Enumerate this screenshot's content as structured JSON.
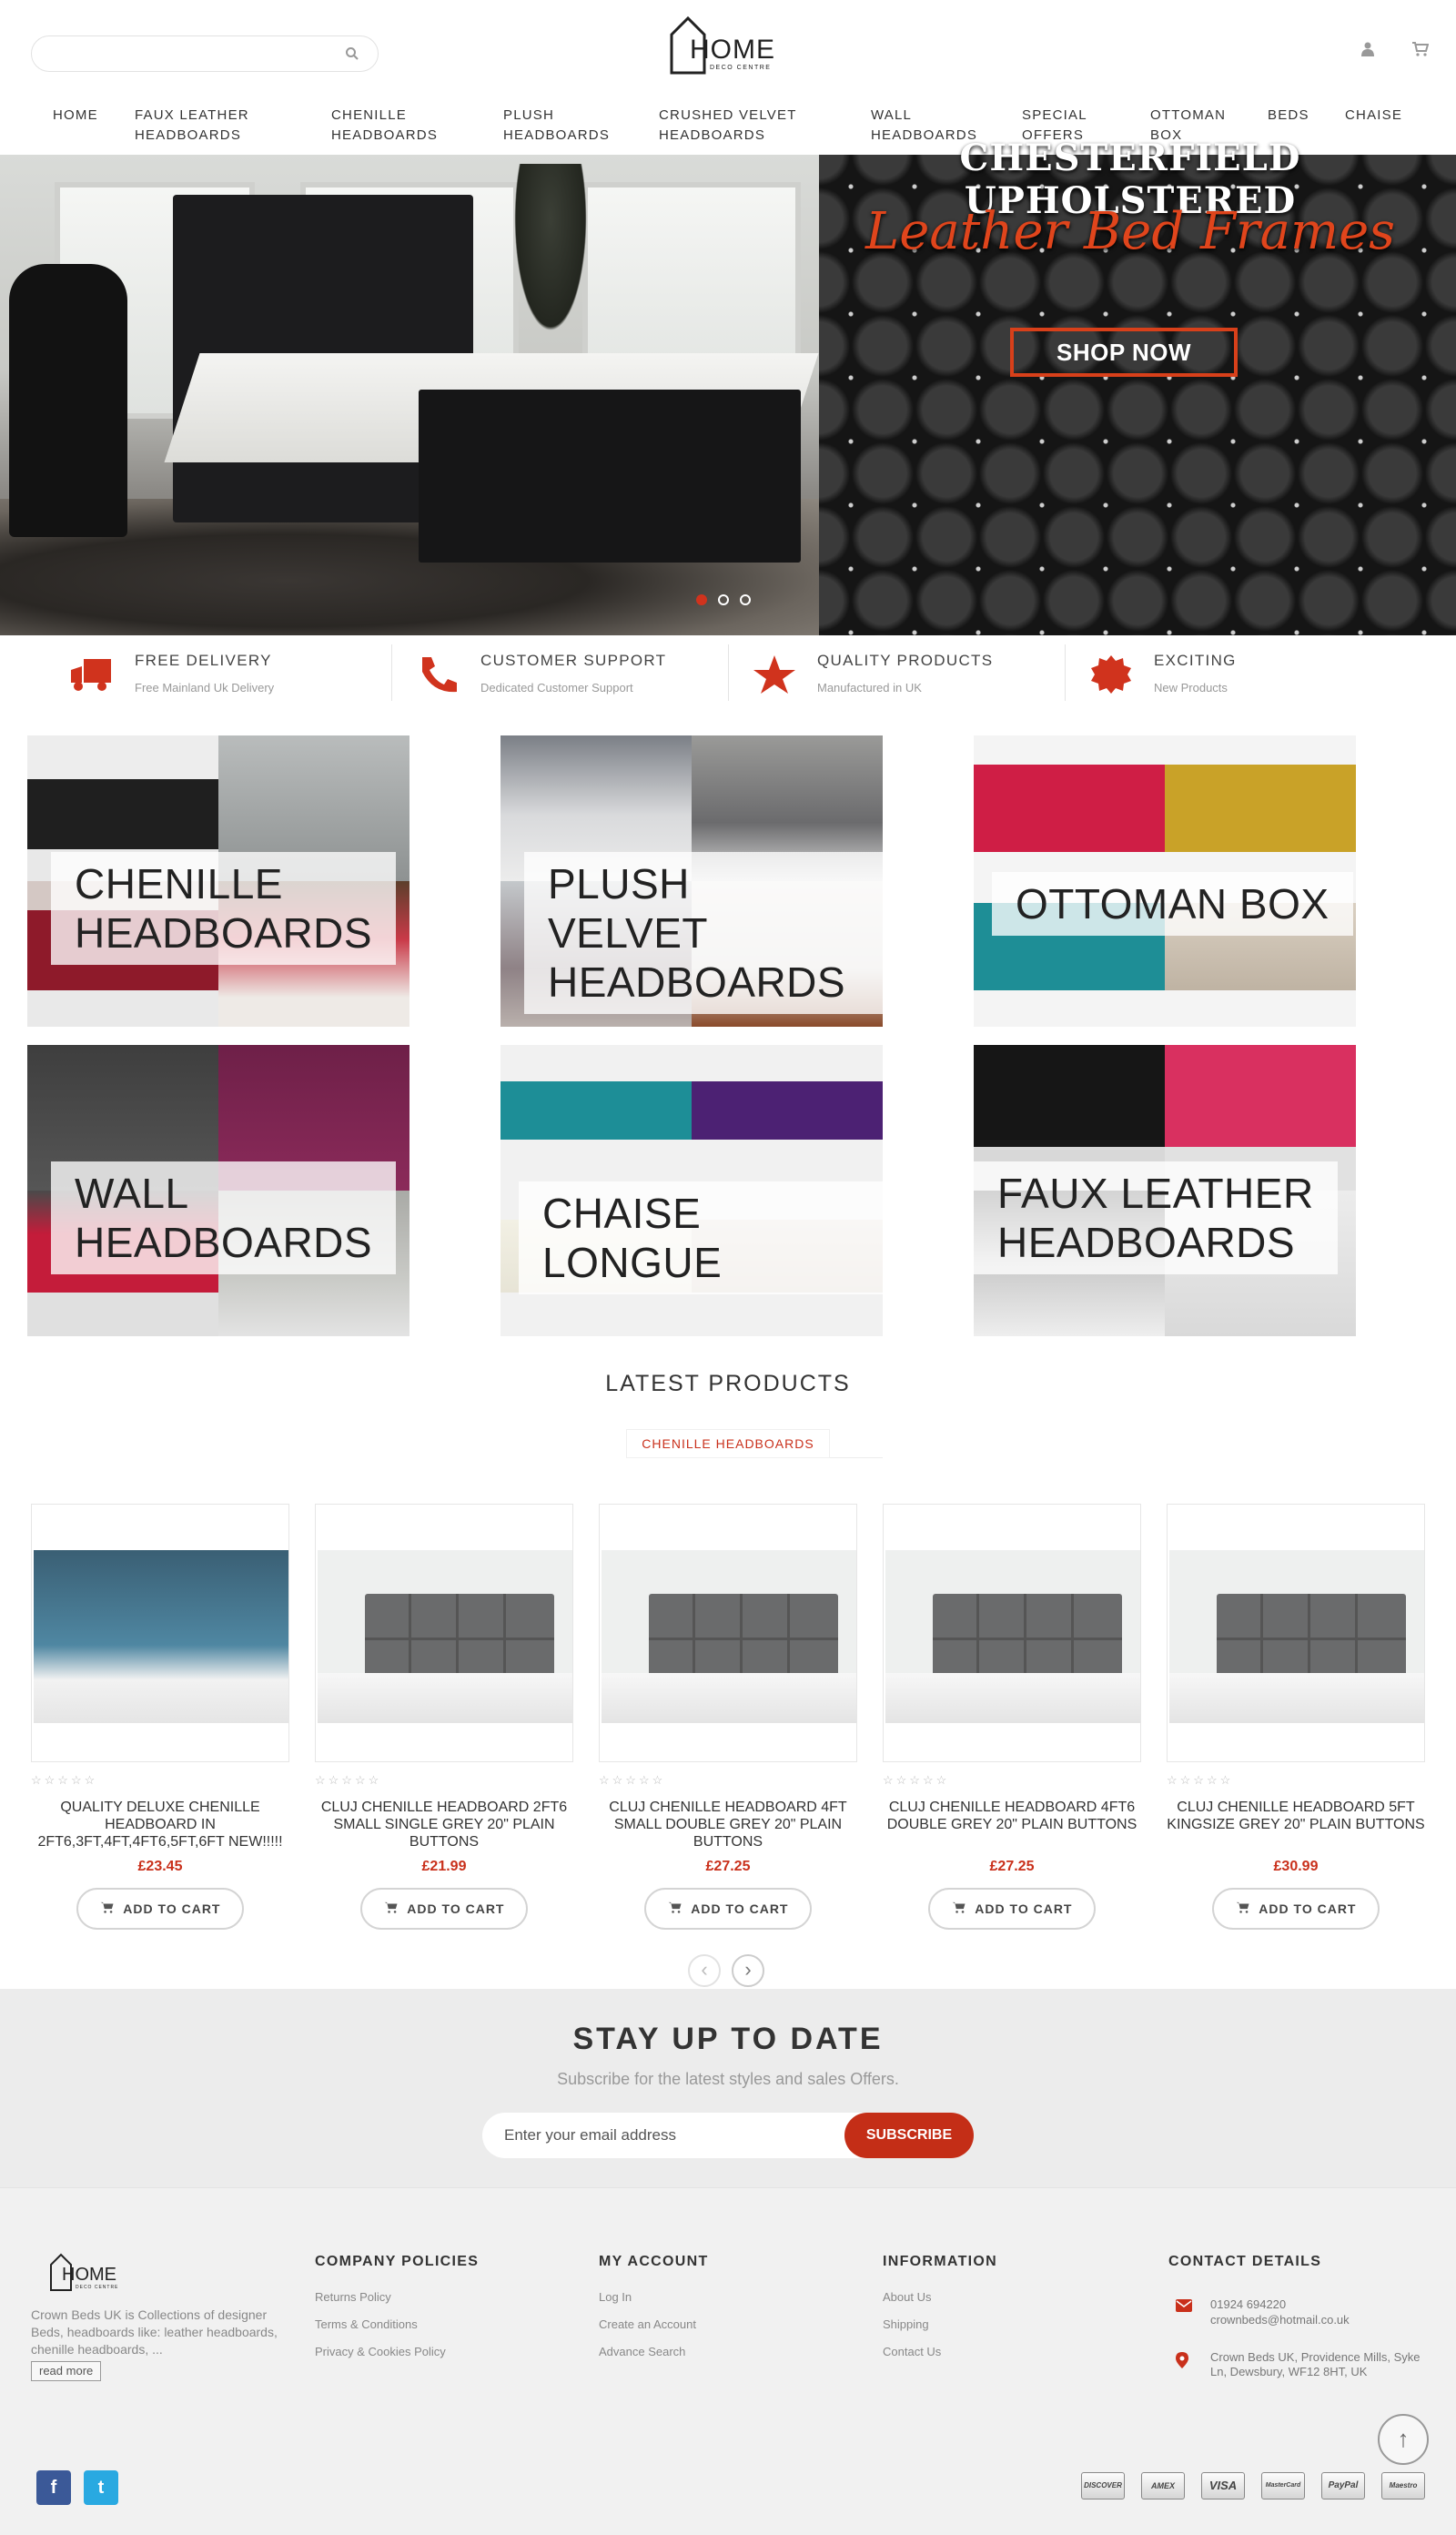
{
  "header": {
    "search": {
      "placeholder": ""
    },
    "logo": {
      "word": "HOME",
      "tagline": "DECO CENTRE"
    },
    "icons": [
      "user-icon",
      "cart-icon"
    ]
  },
  "nav": [
    {
      "label": "HOME"
    },
    {
      "label": "FAUX LEATHER HEADBOARDS"
    },
    {
      "label": "CHENILLE HEADBOARDS"
    },
    {
      "label": "PLUSH HEADBOARDS"
    },
    {
      "label": "CRUSHED VELVET HEADBOARDS"
    },
    {
      "label": "WALL HEADBOARDS"
    },
    {
      "label": "SPECIAL OFFERS"
    },
    {
      "label": "OTTOMAN BOX"
    },
    {
      "label": "BEDS"
    },
    {
      "label": "CHAISE"
    }
  ],
  "hero": {
    "title": "CHESTERFIELD UPHOLSTERED",
    "script": "Leather Bed Frames",
    "cta": "SHOP NOW",
    "slide_count": 3,
    "active_slide": 1
  },
  "features": [
    {
      "icon": "truck-icon",
      "title": "FREE DELIVERY",
      "subtitle": "Free Mainland Uk Delivery"
    },
    {
      "icon": "phone-icon",
      "title": "CUSTOMER SUPPORT",
      "subtitle": "Dedicated Customer Support"
    },
    {
      "icon": "star-icon",
      "title": "QUALITY PRODUCTS",
      "subtitle": "Manufactured in UK"
    },
    {
      "icon": "badge-icon",
      "title": "EXCITING",
      "subtitle": "New Products"
    }
  ],
  "categories": [
    {
      "label": "CHENILLE\nHEADBOARDS"
    },
    {
      "label": "PLUSH VELVET\nHEADBOARDS"
    },
    {
      "label": "OTTOMAN BOX"
    },
    {
      "label": "WALL\nHEADBOARDS"
    },
    {
      "label": "CHAISE LONGUE"
    },
    {
      "label": "FAUX LEATHER\nHEADBOARDS"
    }
  ],
  "latest": {
    "title": "LATEST PRODUCTS",
    "tab": "CHENILLE HEADBOARDS",
    "add_to_cart": "ADD TO CART",
    "rating_stars": "☆☆☆☆☆",
    "products": [
      {
        "name": "QUALITY DELUXE CHENILLE HEADBOARD IN 2ft6,3ft,4ft,4ft6,5ft,6ft NEW!!!!!",
        "price": "£23.45"
      },
      {
        "name": "CLUJ CHENILLE HEADBOARD 2FT6 SMALL SINGLE GREY 20\" PLAIN BUTTONS",
        "price": "£21.99"
      },
      {
        "name": "CLUJ CHENILLE HEADBOARD 4FT SMALL DOUBLE GREY 20\" PLAIN BUTTONS",
        "price": "£27.25"
      },
      {
        "name": "CLUJ CHENILLE HEADBOARD 4FT6 DOUBLE GREY 20\" PLAIN BUTTONS",
        "price": "£27.25"
      },
      {
        "name": "CLUJ CHENILLE HEADBOARD 5FT KINGSIZE GREY 20\" PLAIN BUTTONS",
        "price": "£30.99"
      }
    ]
  },
  "newsletter": {
    "title": "STAY UP TO DATE",
    "subtitle": "Subscribe for the latest styles and sales Offers.",
    "placeholder": "Enter your email address",
    "button": "SUBSCRIBE"
  },
  "footer": {
    "about": "Crown Beds UK is Collections of designer Beds, headboards like: leather headboards, chenille headboards, ...",
    "read_more": "read more",
    "columns": [
      {
        "title": "COMPANY POLICIES",
        "links": [
          "Returns Policy",
          "Terms & Conditions",
          "Privacy & Cookies Policy"
        ]
      },
      {
        "title": "MY ACCOUNT",
        "links": [
          "Log In",
          "Create an Account",
          "Advance Search"
        ]
      },
      {
        "title": "INFORMATION",
        "links": [
          "About Us",
          "Shipping",
          "Contact Us"
        ]
      }
    ],
    "contact": {
      "title": "CONTACT DETAILS",
      "phone": "01924 694220",
      "email": "crownbeds@hotmail.co.uk",
      "address": "Crown Beds UK, Providence Mills, Syke Ln, Dewsbury, WF12 8HT, UK"
    },
    "social": [
      "f",
      "t"
    ],
    "payments": [
      "DISCOVER",
      "AMEX",
      "VISA",
      "MasterCard",
      "PayPal",
      "Maestro"
    ],
    "colors": {
      "accent": "#c9301b",
      "facebook": "#3b5998",
      "twitter": "#29a9e1"
    }
  }
}
